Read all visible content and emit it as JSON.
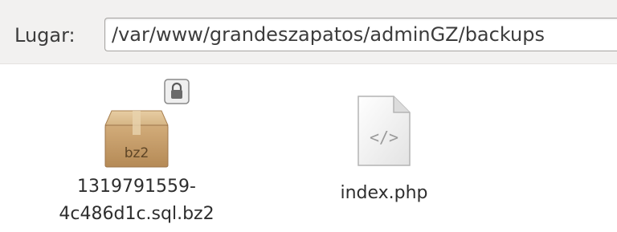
{
  "location": {
    "label": "Lugar:",
    "path": "/var/www/grandeszapatos/adminGZ/backups"
  },
  "files": [
    {
      "name_line1": "1319791559-",
      "name_line2": "4c486d1c.sql.bz2",
      "icon": "archive-box-icon",
      "icon_text": "bz2",
      "emblem": "lock-icon"
    },
    {
      "name": "index.php",
      "icon": "code-document-icon",
      "icon_text": "</>"
    }
  ]
}
